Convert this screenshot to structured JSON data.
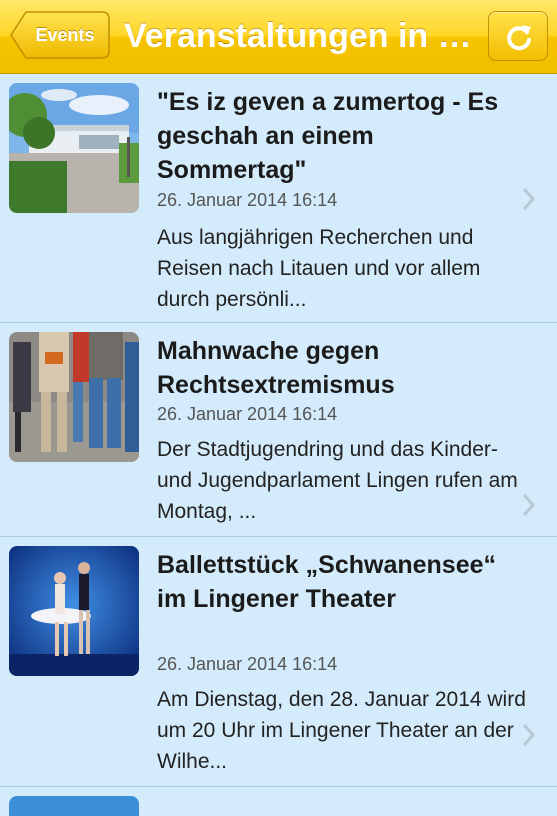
{
  "navbar": {
    "back_label": "Events",
    "title": "Veranstaltungen in Lingen",
    "refresh_icon": "refresh-icon",
    "accent": "#f5c800"
  },
  "events": [
    {
      "title": "\"Es iz geven a zumertog - Es geschah an einem Sommertag\"",
      "date": "26. Januar 2014 16:14",
      "description": "Aus langjährigen Recherchen und Reisen nach Litauen und vor allem durch persönli..."
    },
    {
      "title": "Mahnwache gegen Rechtsextremismus",
      "date": "26. Januar 2014 16:14",
      "description": "Der Stadtjugendring und das Kinder- und Jugendparlament Lingen rufen am Montag, ..."
    },
    {
      "title": "Ballettstück „Schwanensee“ im Lingener Theater",
      "date": "26. Januar 2014 16:14",
      "description": "Am Dienstag, den 28. Januar 2014 wird um 20 Uhr im Lingener Theater an der Wilhe..."
    }
  ]
}
